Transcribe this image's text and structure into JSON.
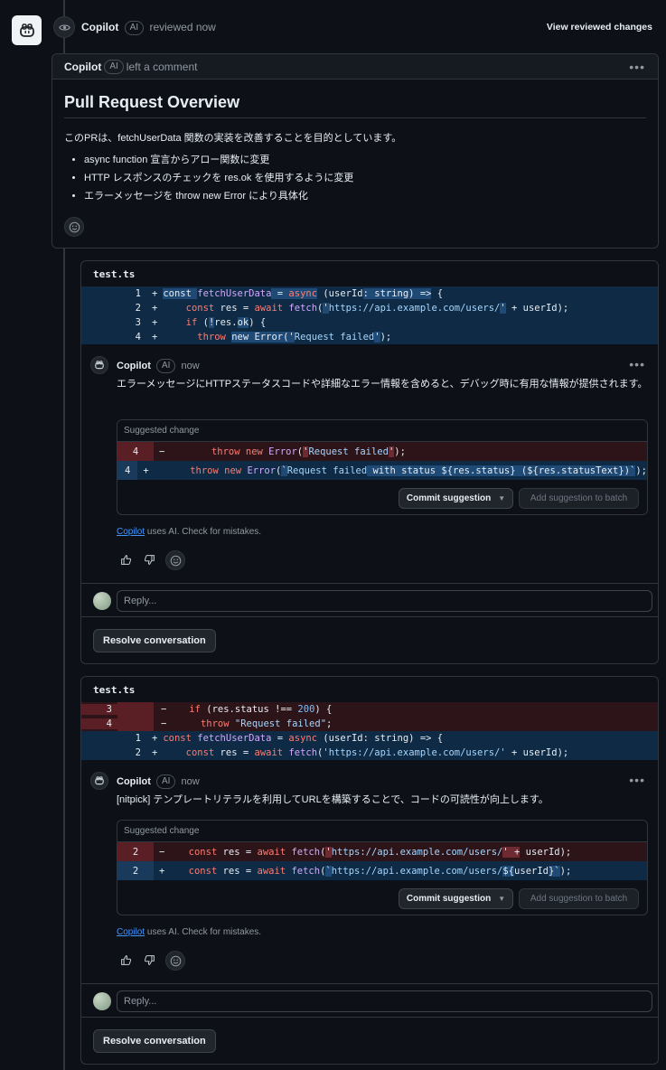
{
  "review": {
    "reviewer": "Copilot",
    "ai_badge": "AI",
    "action": "reviewed now",
    "view_changes": "View reviewed changes"
  },
  "overview": {
    "author": "Copilot",
    "ai_badge": "AI",
    "action": "left a comment",
    "title": "Pull Request Overview",
    "description": "このPRは、fetchUserData 関数の実装を改善することを目的としています。",
    "bullets": [
      "async function 宣言からアロー関数に変更",
      "HTTP レスポンスのチェックを res.ok を使用するように変更",
      "エラーメッセージを throw new Error により具体化"
    ]
  },
  "threads": [
    {
      "file": "test.ts",
      "diff": [
        {
          "old": "",
          "new": "1",
          "type": "add",
          "sign": "+",
          "code": "const fetchUserData = async (userId: string) => {"
        },
        {
          "old": "",
          "new": "2",
          "type": "add",
          "sign": "+",
          "code": "  const res = await fetch('https://api.example.com/users/' + userId);"
        },
        {
          "old": "",
          "new": "3",
          "type": "add",
          "sign": "+",
          "code": "  if (!res.ok) {"
        },
        {
          "old": "",
          "new": "4",
          "type": "add",
          "sign": "+",
          "code": "    throw new Error('Request failed');"
        }
      ],
      "comment": {
        "author": "Copilot",
        "ai_badge": "AI",
        "time": "now",
        "body": "エラーメッセージにHTTPステータスコードや詳細なエラー情報を含めると、デバッグ時に有用な情報が提供されます。"
      },
      "suggestion": {
        "header": "Suggested change",
        "rows": [
          {
            "ln": "4",
            "type": "del",
            "sign": "−",
            "code": "      throw new Error('Request failed');"
          },
          {
            "ln": "4",
            "type": "add",
            "sign": "+",
            "code": "      throw new Error(`Request failed with status ${res.status} (${res.statusText})`);"
          }
        ],
        "commit_label": "Commit suggestion",
        "batch_label": "Add suggestion to batch"
      },
      "footnote_link": "Copilot",
      "footnote_text": " uses AI. Check for mistakes.",
      "reply_placeholder": "Reply...",
      "resolve_label": "Resolve conversation"
    },
    {
      "file": "test.ts",
      "diff": [
        {
          "old": "3",
          "new": "",
          "type": "del",
          "sign": "−",
          "code": "  if (res.status !== 200) {"
        },
        {
          "old": "4",
          "new": "",
          "type": "del",
          "sign": "−",
          "code": "    throw \"Request failed\";"
        },
        {
          "old": "",
          "new": "1",
          "type": "add",
          "sign": "+",
          "code": "const fetchUserData = async (userId: string) => {"
        },
        {
          "old": "",
          "new": "2",
          "type": "add",
          "sign": "+",
          "code": "  const res = await fetch('https://api.example.com/users/' + userId);"
        }
      ],
      "comment": {
        "author": "Copilot",
        "ai_badge": "AI",
        "time": "now",
        "body": "[nitpick] テンプレートリテラルを利用してURLを構築することで、コードの可読性が向上します。"
      },
      "suggestion": {
        "header": "Suggested change",
        "rows": [
          {
            "ln": "2",
            "type": "del",
            "sign": "−",
            "code": "  const res = await fetch('https://api.example.com/users/' + userId);"
          },
          {
            "ln": "2",
            "type": "add",
            "sign": "+",
            "code": "  const res = await fetch(`https://api.example.com/users/${userId}`);"
          }
        ],
        "commit_label": "Commit suggestion",
        "batch_label": "Add suggestion to batch"
      },
      "footnote_link": "Copilot",
      "footnote_text": " uses AI. Check for mistakes.",
      "reply_placeholder": "Reply...",
      "resolve_label": "Resolve conversation"
    }
  ]
}
